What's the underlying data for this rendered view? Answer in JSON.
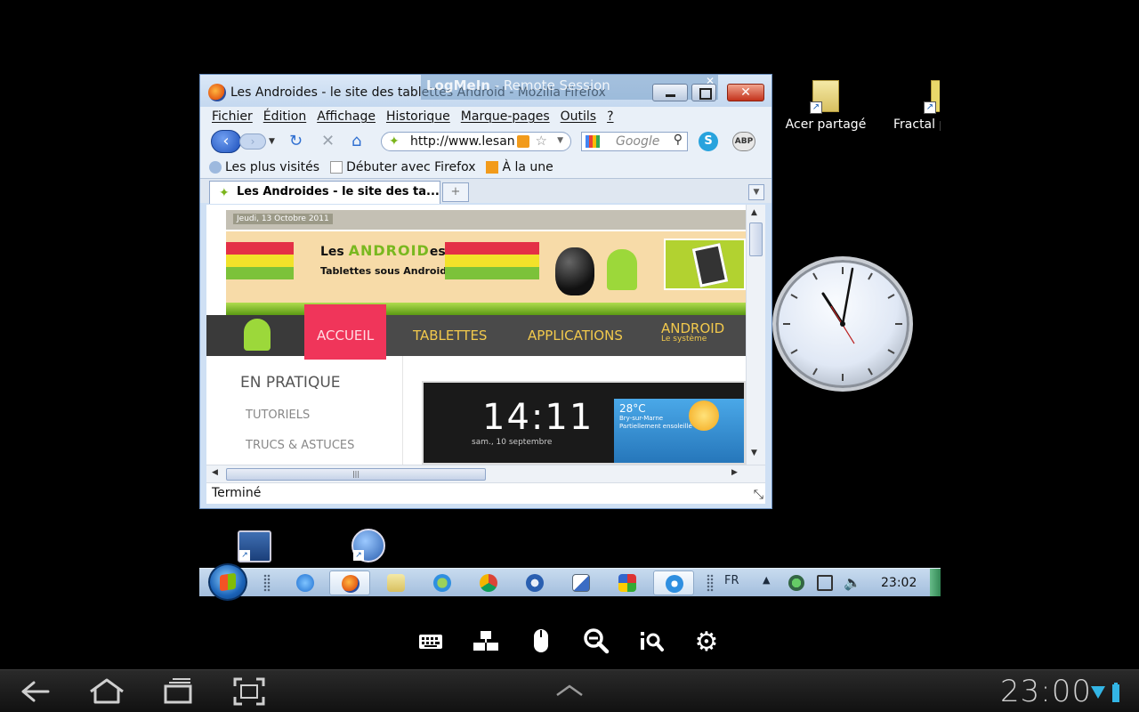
{
  "desktop": {
    "icons": [
      {
        "label": "Acer partagé"
      },
      {
        "label": "Fractal p"
      }
    ]
  },
  "firefox": {
    "title": "Les Androides - le site des tablettes Android - Mozilla Firefox",
    "overlay": {
      "brand": "LogMeIn",
      "subtitle": " - Remote Session",
      "close": "✕"
    },
    "menu": [
      "Fichier",
      "Édition",
      "Affichage",
      "Historique",
      "Marque-pages",
      "Outils",
      "?"
    ],
    "url": "http://www.lesan",
    "search_placeholder": "Google",
    "abp": "ABP",
    "bookmarks": [
      "Les plus visités",
      "Débuter avec Firefox",
      "À la une"
    ],
    "tab_title": "Les Androides - le site des ta...",
    "tab_new": "+",
    "status": "Terminé"
  },
  "page": {
    "date": "Jeudi, 13 Octobre 2011",
    "banner_les": "Les ",
    "banner_android": "ANDROID",
    "banner_es": "es",
    "banner_sub": "Tablettes sous Android",
    "nav": [
      {
        "label": "ACCUEIL"
      },
      {
        "label": "TABLETTES"
      },
      {
        "label": "APPLICATIONS"
      },
      {
        "label": "ANDROID",
        "sub": "Le système"
      }
    ],
    "sidebar_title": "EN PRATIQUE",
    "sidebar_links": [
      "TUTORIELS",
      "TRUCS & ASTUCES"
    ],
    "screenshot": {
      "clock": "14:11",
      "date": "sam., 10 septembre",
      "temp": "28°C",
      "location": "Bry-sur-Marne",
      "condition": "Partiellement ensoleillé"
    }
  },
  "taskbar": {
    "lang": "FR",
    "time": "23:02"
  },
  "lmi_toolbar": {
    "icons": [
      "keyboard-icon",
      "network-icon",
      "mouse-icon",
      "zoom-out-icon",
      "zoom-fit-icon",
      "gear-icon"
    ]
  },
  "android": {
    "time": "23:00"
  },
  "colors": {
    "accent_active_nav": "#f0355a",
    "android_green": "#9cd83a",
    "nav_text": "#f2c94c"
  }
}
